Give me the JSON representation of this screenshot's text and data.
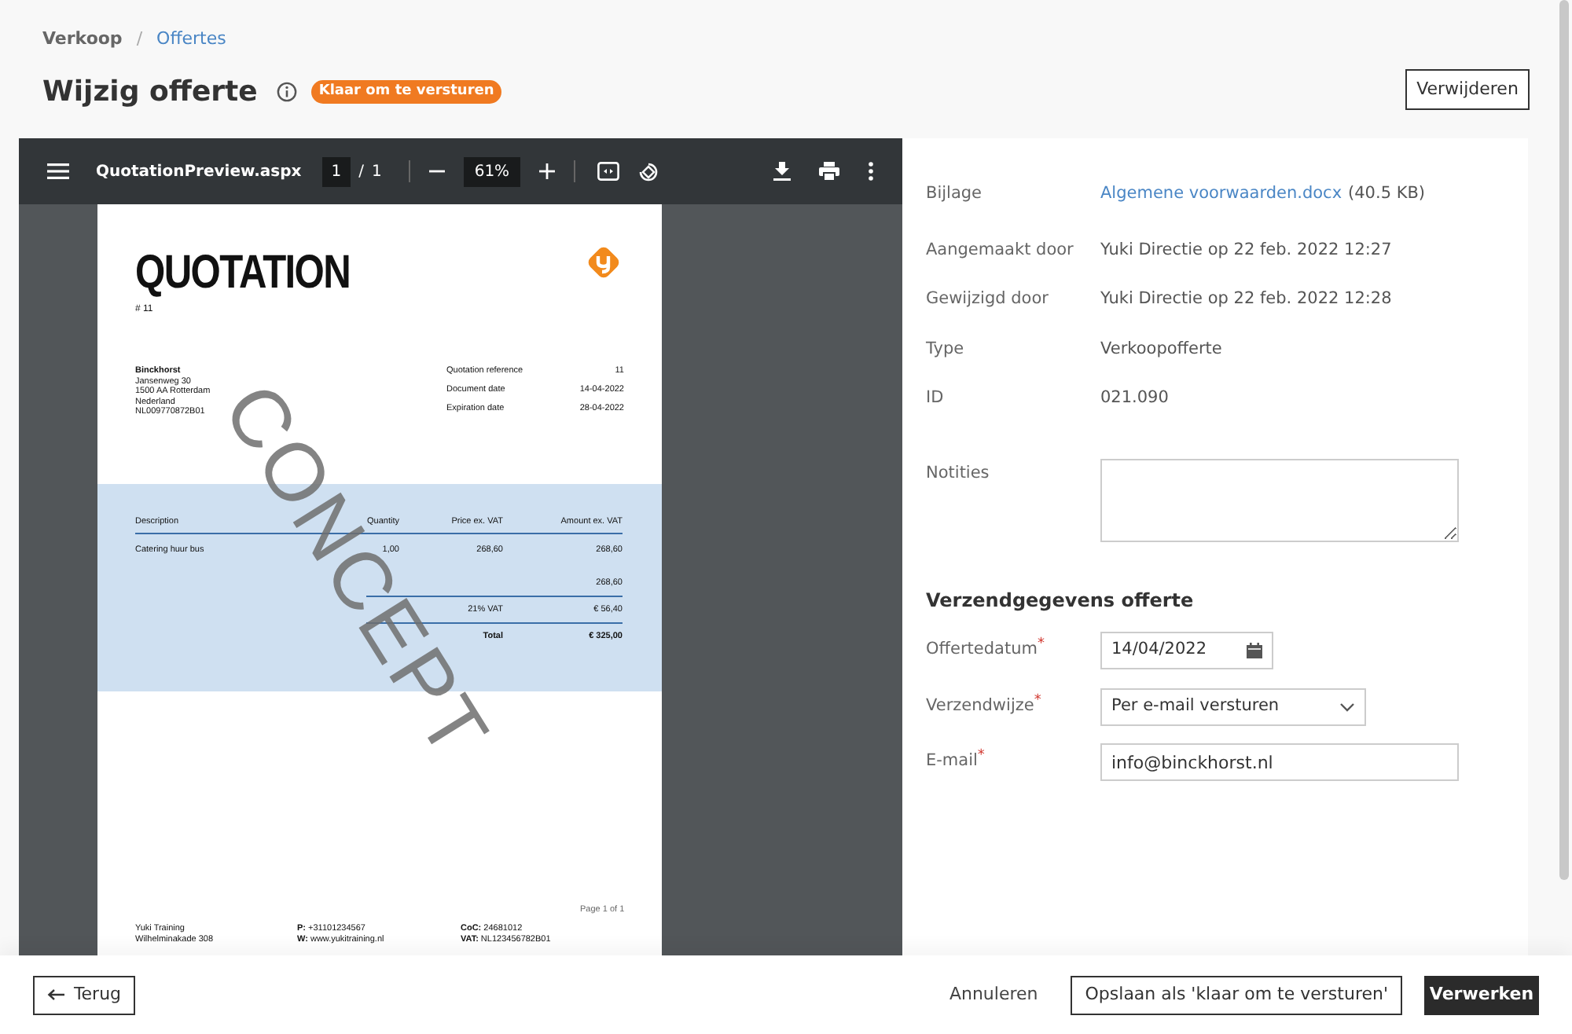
{
  "breadcrumb": [
    {
      "label": "Verkoop",
      "kind": "text"
    },
    {
      "label": "/",
      "kind": "separator"
    },
    {
      "label": "Offertes",
      "kind": "link"
    }
  ],
  "title": "Wijzig offerte",
  "status_badge": "Klaar om te versturen",
  "delete_button": "Verwijderen",
  "pdf_viewer": {
    "file_name": "QuotationPreview.aspx",
    "page_current": "1",
    "page_separator": "/",
    "page_total": "1",
    "zoom": "61%"
  },
  "document": {
    "title": "QUOTATION",
    "number": "# 11",
    "customer": [
      "Binckhorst",
      "Jansenweg 30",
      "1500 AA Rotterdam",
      "Nederland",
      "NL009770872B01"
    ],
    "meta": [
      {
        "label": "Quotation reference",
        "value": "11"
      },
      {
        "label": "Document date",
        "value": "14-04-2022"
      },
      {
        "label": "Expiration date",
        "value": "28-04-2022"
      }
    ],
    "columns": [
      "Description",
      "Quantity",
      "Price ex. VAT",
      "Amount ex. VAT"
    ],
    "rows": [
      [
        "Catering huur bus",
        "1,00",
        "268,60",
        "268,60"
      ]
    ],
    "subtotal": "268,60",
    "vat_label": "21% VAT",
    "vat_value": "€ 56,40",
    "total_label": "Total",
    "total_value": "€ 325,00",
    "page_label": "Page 1 of 1",
    "footer": [
      [
        "Yuki Training",
        "Wilhelminakade 308"
      ],
      [
        "**P:** +31101234567",
        "**W:** www.yukitraining.nl"
      ],
      [
        "**CoC:** 24681012",
        "**VAT:** NL123456782B01"
      ]
    ],
    "watermark": "CONCEPT"
  },
  "details": [
    {
      "label": "Bijlage",
      "kind": "link",
      "value": "Algemene voorwaarden.docx",
      "suffix": "(40.5 KB)"
    },
    {
      "label": "Aangemaakt door",
      "kind": "text",
      "value": "Yuki Directie op 22 feb. 2022 12:27"
    },
    {
      "label": "Gewijzigd door",
      "kind": "text",
      "value": "Yuki Directie op 22 feb. 2022 12:28"
    },
    {
      "label": "Type",
      "kind": "text",
      "value": "Verkoopofferte"
    },
    {
      "label": "ID",
      "kind": "text",
      "value": "021.090"
    }
  ],
  "notes_label": "Notities",
  "shipping": {
    "heading": "Verzendgegevens offerte",
    "fields": [
      {
        "label": "Offertedatum",
        "required_mark": "*",
        "kind": "date",
        "value": "14/04/2022"
      },
      {
        "label": "Verzendwijze",
        "required_mark": "*",
        "kind": "select",
        "value": "Per e-mail versturen"
      },
      {
        "label": "E-mail",
        "required_mark": "*",
        "kind": "text",
        "value": "info@binckhorst.nl"
      }
    ]
  },
  "footer": {
    "back": "Terug",
    "cancel": "Annuleren",
    "save": "Opslaan als 'klaar om te versturen'",
    "process": "Verwerken"
  }
}
